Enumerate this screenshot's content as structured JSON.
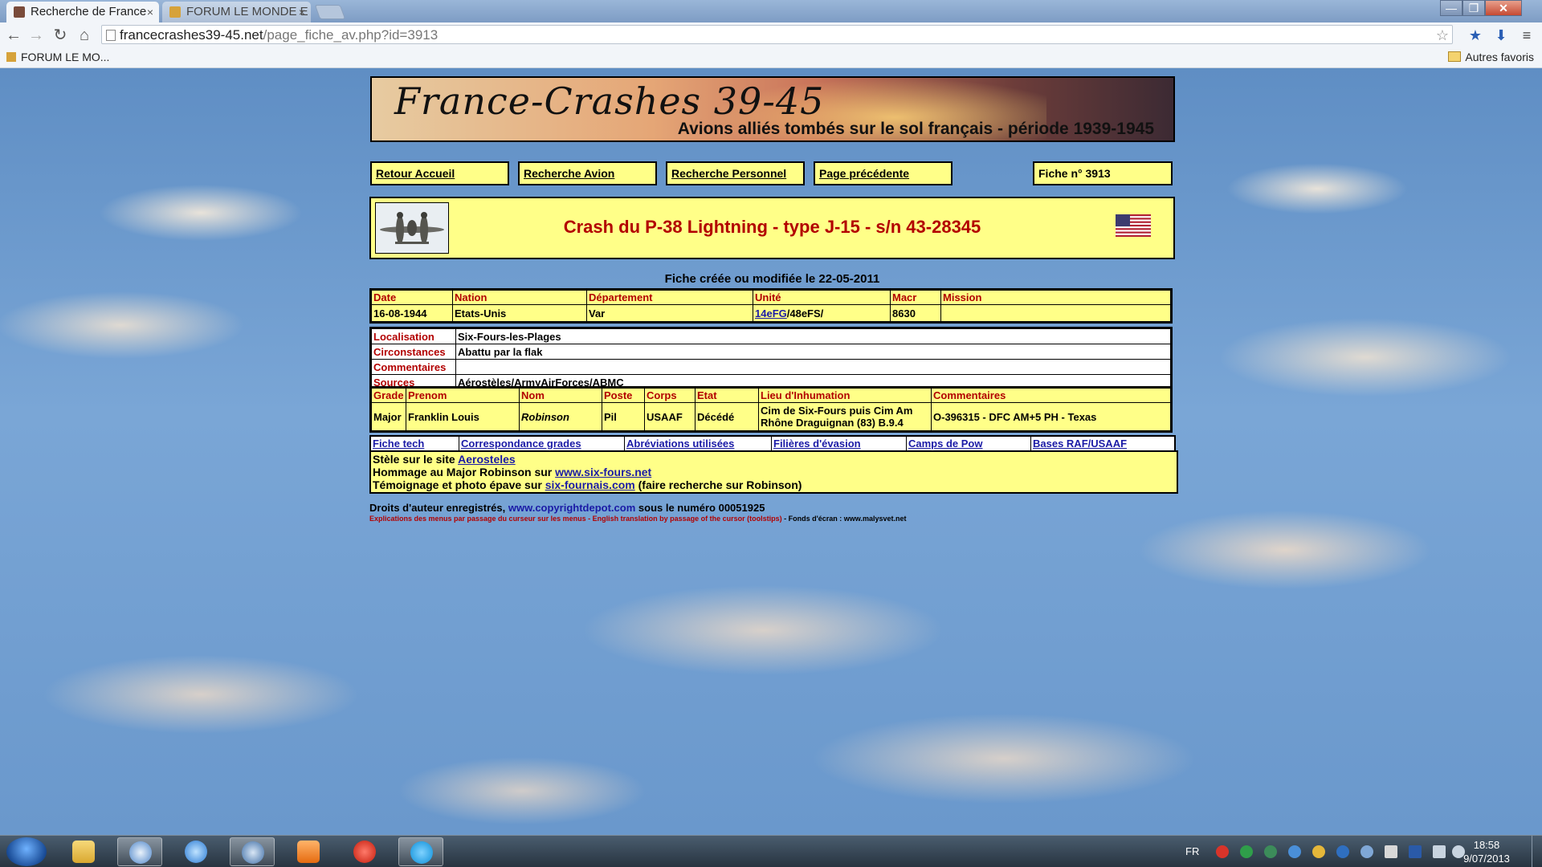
{
  "browser": {
    "tabs": [
      {
        "label": "Recherche de France",
        "close": "×",
        "active": true
      },
      {
        "label": "FORUM LE MONDE E",
        "close": "×",
        "active": false
      }
    ],
    "window_controls": {
      "minimize": "—",
      "maximize": "❐",
      "close": "✕"
    },
    "url_host": "francecrashes39-45.net",
    "url_path": "/page_fiche_av.php?id=3913",
    "bookmarks": [
      {
        "label": "FORUM LE MO..."
      }
    ],
    "other_bookmarks": "Autres favoris"
  },
  "site": {
    "title": "France-Crashes 39-45",
    "subtitle": "Avions alliés tombés sur le sol français - période 1939-1945",
    "nav": {
      "home": "Retour Accueil",
      "search_plane": "Recherche Avion",
      "search_personnel": "Recherche Personnel",
      "previous": "Page précédente",
      "record_number": "Fiche n° 3913"
    },
    "crash_title": "Crash du P-38 Lightning - type J-15 - s/n 43-28345",
    "date_line": "Fiche créée ou modifiée le 22-05-2011",
    "summary": {
      "headers": [
        "Date",
        "Nation",
        "Département",
        "Unité",
        "Macr",
        "Mission"
      ],
      "date": "16-08-1944",
      "nation": "Etats-Unis",
      "departement": "Var",
      "unite_link": "14eFG",
      "unite_rest": "/48eFS/",
      "macr": "8630",
      "mission": ""
    },
    "details": {
      "localisation_label": "Localisation",
      "localisation": "Six-Fours-les-Plages",
      "circonstances_label": "Circonstances",
      "circonstances": "Abattu par la flak",
      "commentaires_label": "Commentaires",
      "commentaires": "",
      "sources_label": "Sources",
      "sources": "Aérostèles/ArmyAirForces/ABMC"
    },
    "crew": {
      "headers": [
        "Grade",
        "Prenom",
        "Nom",
        "Poste",
        "Corps",
        "Etat",
        "Lieu d'Inhumation",
        "Commentaires"
      ],
      "rows": [
        {
          "grade": "Major",
          "prenom": "Franklin Louis",
          "nom": "Robinson",
          "poste": "Pil",
          "corps": "USAAF",
          "etat": "Décédé",
          "lieu": "Cim de Six-Fours puis Cim Am Rhône Draguignan (83) B.9.4",
          "commentaires": "O-396315 - DFC AM+5 PH - Texas"
        }
      ]
    },
    "links": [
      "Fiche tech",
      "Correspondance grades",
      "Abréviations utilisées",
      "Filières d'évasion",
      "Camps de Pow",
      "Bases RAF/USAAF"
    ],
    "notes": {
      "line1_text": "Stèle sur le site ",
      "line1_link": "Aerosteles ",
      "line2_text": "Hommage au Major Robinson sur ",
      "line2_link": "www.six-fours.net",
      "line3_text": "Témoignage et photo épave sur ",
      "line3_link": "six-fournais.com",
      "line3_suffix": " (faire recherche sur Robinson)"
    },
    "copyright": {
      "prefix": "Droits d'auteur enregistrés, ",
      "link": "www.copyrightdepot.com",
      "suffix": " sous le numéro 00051925"
    },
    "tooltip_note": {
      "red": "Explications des menus par passage du curseur sur les menus - English translation by passage of the cursor (toolstips)",
      "black": " - Fonds d'écran : www.malysvet.net"
    }
  },
  "taskbar": {
    "language": "FR",
    "time": "18:58",
    "date": "9/07/2013"
  },
  "colors": {
    "yellow_panel": "#ffff88",
    "header_red": "#b20000",
    "link_blue": "#1a1aa6"
  }
}
